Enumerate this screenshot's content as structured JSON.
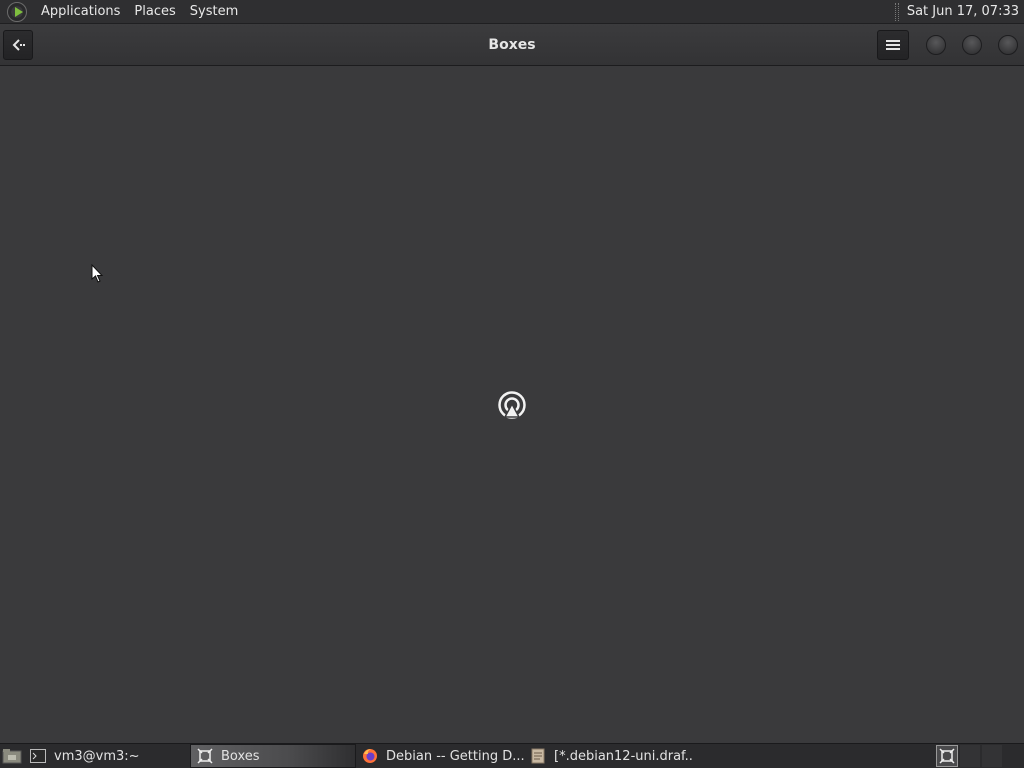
{
  "top_panel": {
    "menus": [
      "Applications",
      "Places",
      "System"
    ],
    "clock": "Sat Jun 17, 07:33"
  },
  "window": {
    "title": "Boxes",
    "icons": {
      "back": "back-arrow-icon",
      "menu": "hamburger-menu-icon",
      "center": "remote-display-icon"
    }
  },
  "taskbar": {
    "tasks": [
      {
        "label": "vm3@vm3:~",
        "icon": "terminal-icon"
      },
      {
        "label": "Boxes",
        "icon": "boxes-icon"
      },
      {
        "label": "Debian -- Getting D...",
        "icon": "firefox-icon"
      },
      {
        "label": "[*.debian12-uni.draf...",
        "icon": "text-editor-icon"
      }
    ]
  },
  "colors": {
    "background": "#3a3a3c",
    "panel": "#2f2f31",
    "accent": "#7fbf3f"
  }
}
